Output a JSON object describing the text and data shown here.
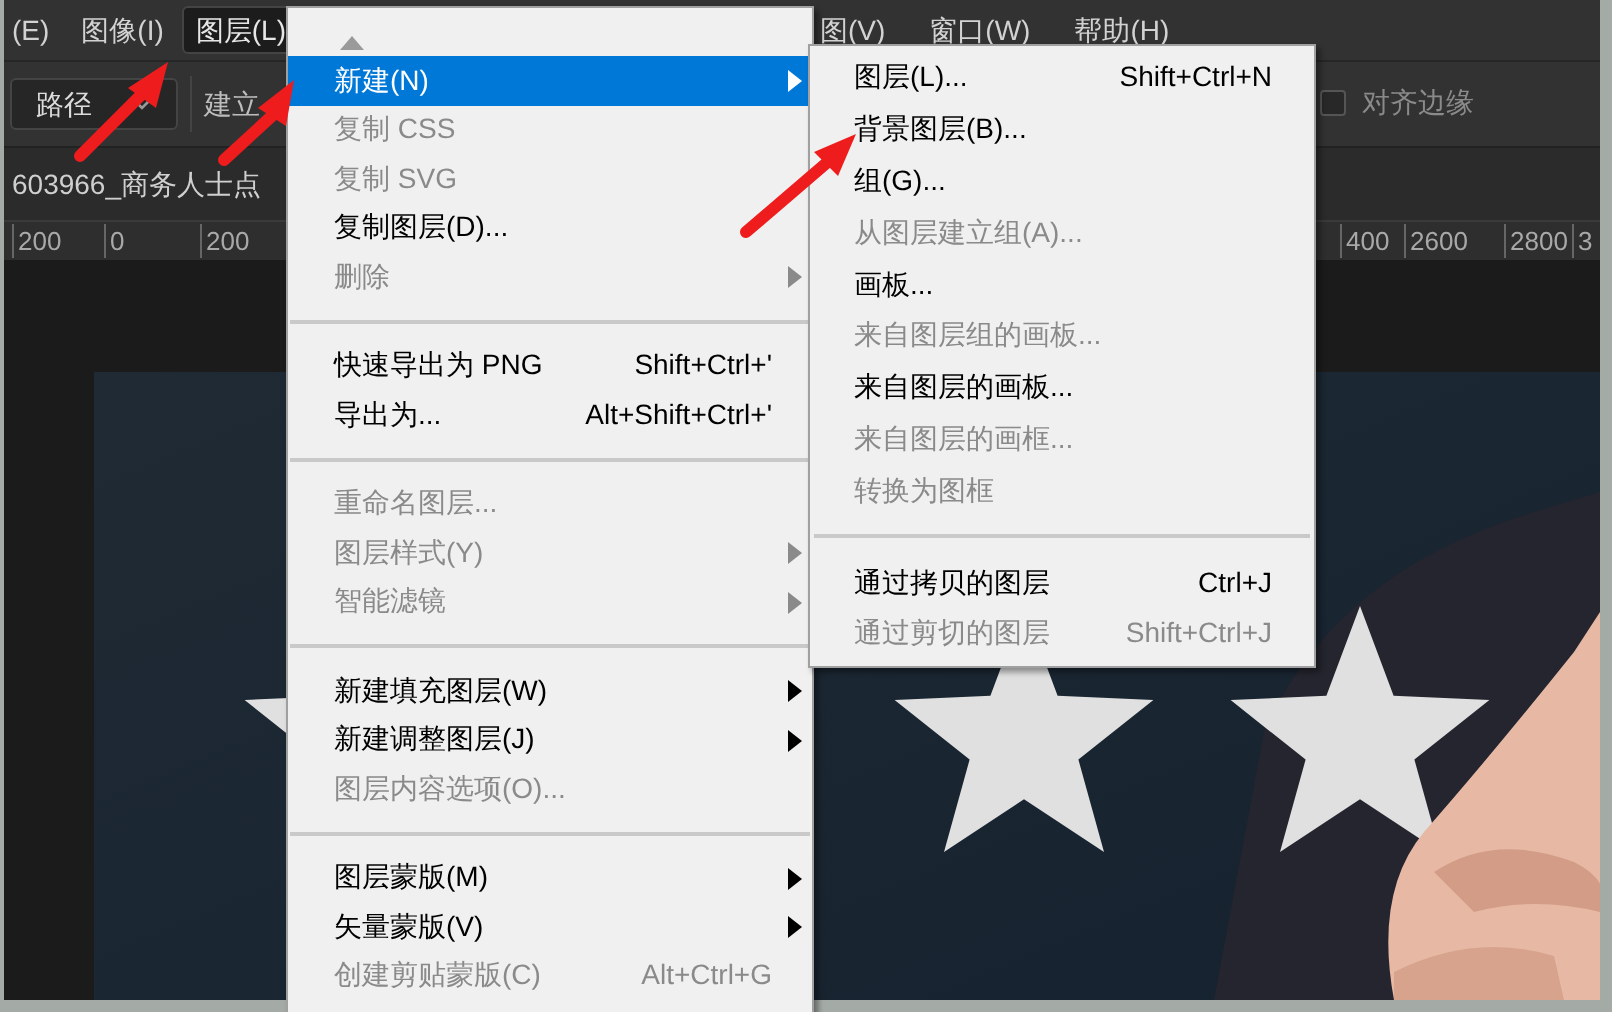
{
  "menu_bar": {
    "items": [
      {
        "label": "(E)",
        "selected": false
      },
      {
        "label": "图像(I)",
        "selected": false
      },
      {
        "label": "图层(L)",
        "selected": true
      },
      {
        "label": "图(V)",
        "selected": false
      },
      {
        "label": "窗口(W)",
        "selected": false
      },
      {
        "label": "帮助(H)",
        "selected": false
      }
    ]
  },
  "options_bar": {
    "mode_dropdown": {
      "value": "路径"
    },
    "make_label": "建立",
    "align_edges": {
      "label": "对齐边缘",
      "checked": false
    }
  },
  "document_tab": {
    "title": "603966_商务人士点"
  },
  "ruler": {
    "labels": [
      "200",
      "0",
      "200",
      "400",
      "2600",
      "2800",
      "3"
    ]
  },
  "layer_menu": {
    "items": [
      {
        "kind": "item",
        "label": "新建(N)",
        "selected": true,
        "disabled": false,
        "submenu": true
      },
      {
        "kind": "item",
        "label": "复制 CSS",
        "selected": false,
        "disabled": true,
        "submenu": false
      },
      {
        "kind": "item",
        "label": "复制 SVG",
        "selected": false,
        "disabled": true,
        "submenu": false
      },
      {
        "kind": "item",
        "label": "复制图层(D)...",
        "selected": false,
        "disabled": false,
        "submenu": false
      },
      {
        "kind": "item",
        "label": "删除",
        "selected": false,
        "disabled": true,
        "submenu": true
      },
      {
        "kind": "separator"
      },
      {
        "kind": "item",
        "label": "快速导出为 PNG",
        "shortcut": "Shift+Ctrl+'",
        "selected": false,
        "disabled": false,
        "submenu": false
      },
      {
        "kind": "item",
        "label": "导出为...",
        "shortcut": "Alt+Shift+Ctrl+'",
        "selected": false,
        "disabled": false,
        "submenu": false
      },
      {
        "kind": "separator"
      },
      {
        "kind": "item",
        "label": "重命名图层...",
        "selected": false,
        "disabled": true,
        "submenu": false
      },
      {
        "kind": "item",
        "label": "图层样式(Y)",
        "selected": false,
        "disabled": true,
        "submenu": true
      },
      {
        "kind": "item",
        "label": "智能滤镜",
        "selected": false,
        "disabled": true,
        "submenu": true
      },
      {
        "kind": "separator"
      },
      {
        "kind": "item",
        "label": "新建填充图层(W)",
        "selected": false,
        "disabled": false,
        "submenu": true
      },
      {
        "kind": "item",
        "label": "新建调整图层(J)",
        "selected": false,
        "disabled": false,
        "submenu": true
      },
      {
        "kind": "item",
        "label": "图层内容选项(O)...",
        "selected": false,
        "disabled": true,
        "submenu": false
      },
      {
        "kind": "separator"
      },
      {
        "kind": "item",
        "label": "图层蒙版(M)",
        "selected": false,
        "disabled": false,
        "submenu": true
      },
      {
        "kind": "item",
        "label": "矢量蒙版(V)",
        "selected": false,
        "disabled": false,
        "submenu": true
      },
      {
        "kind": "item",
        "label": "创建剪贴蒙版(C)",
        "shortcut": "Alt+Ctrl+G",
        "selected": false,
        "disabled": true,
        "submenu": false
      }
    ]
  },
  "new_submenu": {
    "items": [
      {
        "kind": "item",
        "label": "图层(L)...",
        "shortcut": "Shift+Ctrl+N",
        "disabled": false
      },
      {
        "kind": "item",
        "label": "背景图层(B)...",
        "disabled": false
      },
      {
        "kind": "item",
        "label": "组(G)...",
        "disabled": false
      },
      {
        "kind": "item",
        "label": "从图层建立组(A)...",
        "disabled": true
      },
      {
        "kind": "item",
        "label": "画板...",
        "disabled": false
      },
      {
        "kind": "item",
        "label": "来自图层组的画板...",
        "disabled": true
      },
      {
        "kind": "item",
        "label": "来自图层的画板...",
        "disabled": false
      },
      {
        "kind": "item",
        "label": "来自图层的画框...",
        "disabled": true
      },
      {
        "kind": "item",
        "label": "转换为图框",
        "disabled": true
      },
      {
        "kind": "separator"
      },
      {
        "kind": "item",
        "label": "通过拷贝的图层",
        "shortcut": "Ctrl+J",
        "disabled": false
      },
      {
        "kind": "item",
        "label": "通过剪切的图层",
        "shortcut": "Shift+Ctrl+J",
        "disabled": true
      }
    ]
  }
}
